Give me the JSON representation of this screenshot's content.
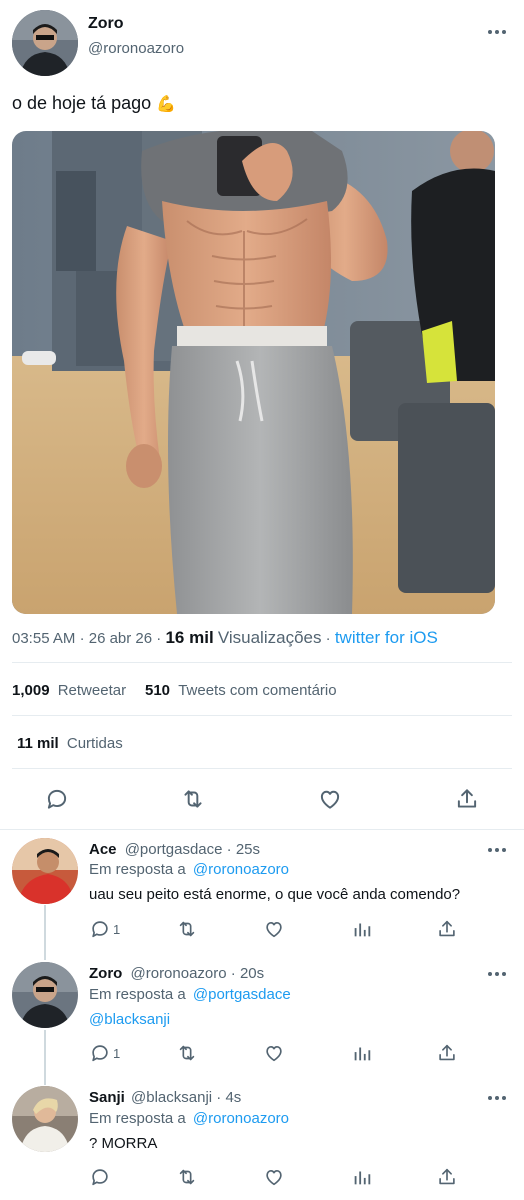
{
  "tweet": {
    "author_name": "Zoro",
    "author_handle": "@roronoazoro",
    "text": "o de hoje tá pago",
    "emoji": "💪",
    "time": "03:55 AM",
    "date": "26 abr 26",
    "views_count": "16 mil",
    "views_label": "Visualizações",
    "source": "twitter for iOS",
    "retweets_count": "1,009",
    "retweets_label": "Retweetar",
    "quotes_count": "510",
    "quotes_label": "Tweets com comentário",
    "likes_count": "11 mil",
    "likes_label": "Curtidas"
  },
  "replies": [
    {
      "name": "Ace",
      "handle": "@portgasdace",
      "time": "· 25s",
      "reply_to_label": "Em resposta a",
      "reply_to": "@roronoazoro",
      "text": "uau seu peito está enorme, o que você anda comendo?",
      "reply_count": "1"
    },
    {
      "name": "Zoro",
      "handle": "@roronoazoro",
      "time": "· 20s",
      "reply_to_label": "Em resposta a",
      "reply_to": "@portgasdace",
      "text": "@blacksanji",
      "reply_count": "1"
    },
    {
      "name": "Sanji",
      "handle": "@blacksanji",
      "time": "· 4s",
      "reply_to_label": "Em resposta a",
      "reply_to": "@roronoazoro",
      "text": "? MORRA",
      "reply_count": ""
    }
  ],
  "colors": {
    "accent": "#1d9bf0",
    "muted": "#536471",
    "divider": "#e6ecf0"
  },
  "icons": [
    "more-icon",
    "reply-icon",
    "retweet-icon",
    "like-icon",
    "share-icon",
    "analytics-icon",
    "flexed-biceps-emoji"
  ]
}
